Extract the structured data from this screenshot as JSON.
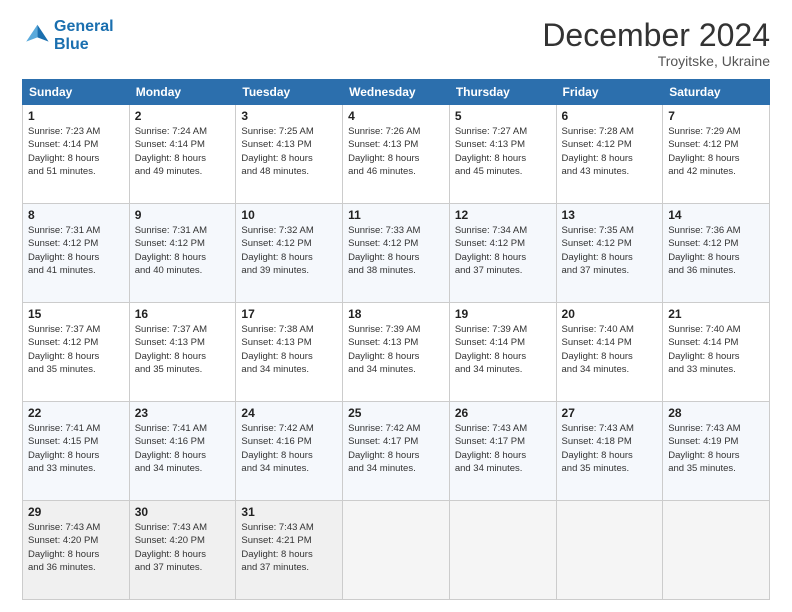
{
  "header": {
    "logo_line1": "General",
    "logo_line2": "Blue",
    "month_title": "December 2024",
    "subtitle": "Troyitske, Ukraine"
  },
  "days_of_week": [
    "Sunday",
    "Monday",
    "Tuesday",
    "Wednesday",
    "Thursday",
    "Friday",
    "Saturday"
  ],
  "weeks": [
    [
      {
        "day": "1",
        "sunrise": "7:23 AM",
        "sunset": "4:14 PM",
        "daylight": "8 hours and 51 minutes."
      },
      {
        "day": "2",
        "sunrise": "7:24 AM",
        "sunset": "4:14 PM",
        "daylight": "8 hours and 49 minutes."
      },
      {
        "day": "3",
        "sunrise": "7:25 AM",
        "sunset": "4:13 PM",
        "daylight": "8 hours and 48 minutes."
      },
      {
        "day": "4",
        "sunrise": "7:26 AM",
        "sunset": "4:13 PM",
        "daylight": "8 hours and 46 minutes."
      },
      {
        "day": "5",
        "sunrise": "7:27 AM",
        "sunset": "4:13 PM",
        "daylight": "8 hours and 45 minutes."
      },
      {
        "day": "6",
        "sunrise": "7:28 AM",
        "sunset": "4:12 PM",
        "daylight": "8 hours and 43 minutes."
      },
      {
        "day": "7",
        "sunrise": "7:29 AM",
        "sunset": "4:12 PM",
        "daylight": "8 hours and 42 minutes."
      }
    ],
    [
      {
        "day": "8",
        "sunrise": "7:31 AM",
        "sunset": "4:12 PM",
        "daylight": "8 hours and 41 minutes."
      },
      {
        "day": "9",
        "sunrise": "7:31 AM",
        "sunset": "4:12 PM",
        "daylight": "8 hours and 40 minutes."
      },
      {
        "day": "10",
        "sunrise": "7:32 AM",
        "sunset": "4:12 PM",
        "daylight": "8 hours and 39 minutes."
      },
      {
        "day": "11",
        "sunrise": "7:33 AM",
        "sunset": "4:12 PM",
        "daylight": "8 hours and 38 minutes."
      },
      {
        "day": "12",
        "sunrise": "7:34 AM",
        "sunset": "4:12 PM",
        "daylight": "8 hours and 37 minutes."
      },
      {
        "day": "13",
        "sunrise": "7:35 AM",
        "sunset": "4:12 PM",
        "daylight": "8 hours and 37 minutes."
      },
      {
        "day": "14",
        "sunrise": "7:36 AM",
        "sunset": "4:12 PM",
        "daylight": "8 hours and 36 minutes."
      }
    ],
    [
      {
        "day": "15",
        "sunrise": "7:37 AM",
        "sunset": "4:12 PM",
        "daylight": "8 hours and 35 minutes."
      },
      {
        "day": "16",
        "sunrise": "7:37 AM",
        "sunset": "4:13 PM",
        "daylight": "8 hours and 35 minutes."
      },
      {
        "day": "17",
        "sunrise": "7:38 AM",
        "sunset": "4:13 PM",
        "daylight": "8 hours and 34 minutes."
      },
      {
        "day": "18",
        "sunrise": "7:39 AM",
        "sunset": "4:13 PM",
        "daylight": "8 hours and 34 minutes."
      },
      {
        "day": "19",
        "sunrise": "7:39 AM",
        "sunset": "4:14 PM",
        "daylight": "8 hours and 34 minutes."
      },
      {
        "day": "20",
        "sunrise": "7:40 AM",
        "sunset": "4:14 PM",
        "daylight": "8 hours and 34 minutes."
      },
      {
        "day": "21",
        "sunrise": "7:40 AM",
        "sunset": "4:14 PM",
        "daylight": "8 hours and 33 minutes."
      }
    ],
    [
      {
        "day": "22",
        "sunrise": "7:41 AM",
        "sunset": "4:15 PM",
        "daylight": "8 hours and 33 minutes."
      },
      {
        "day": "23",
        "sunrise": "7:41 AM",
        "sunset": "4:16 PM",
        "daylight": "8 hours and 34 minutes."
      },
      {
        "day": "24",
        "sunrise": "7:42 AM",
        "sunset": "4:16 PM",
        "daylight": "8 hours and 34 minutes."
      },
      {
        "day": "25",
        "sunrise": "7:42 AM",
        "sunset": "4:17 PM",
        "daylight": "8 hours and 34 minutes."
      },
      {
        "day": "26",
        "sunrise": "7:43 AM",
        "sunset": "4:17 PM",
        "daylight": "8 hours and 34 minutes."
      },
      {
        "day": "27",
        "sunrise": "7:43 AM",
        "sunset": "4:18 PM",
        "daylight": "8 hours and 35 minutes."
      },
      {
        "day": "28",
        "sunrise": "7:43 AM",
        "sunset": "4:19 PM",
        "daylight": "8 hours and 35 minutes."
      }
    ],
    [
      {
        "day": "29",
        "sunrise": "7:43 AM",
        "sunset": "4:20 PM",
        "daylight": "8 hours and 36 minutes."
      },
      {
        "day": "30",
        "sunrise": "7:43 AM",
        "sunset": "4:20 PM",
        "daylight": "8 hours and 37 minutes."
      },
      {
        "day": "31",
        "sunrise": "7:43 AM",
        "sunset": "4:21 PM",
        "daylight": "8 hours and 37 minutes."
      },
      null,
      null,
      null,
      null
    ]
  ]
}
